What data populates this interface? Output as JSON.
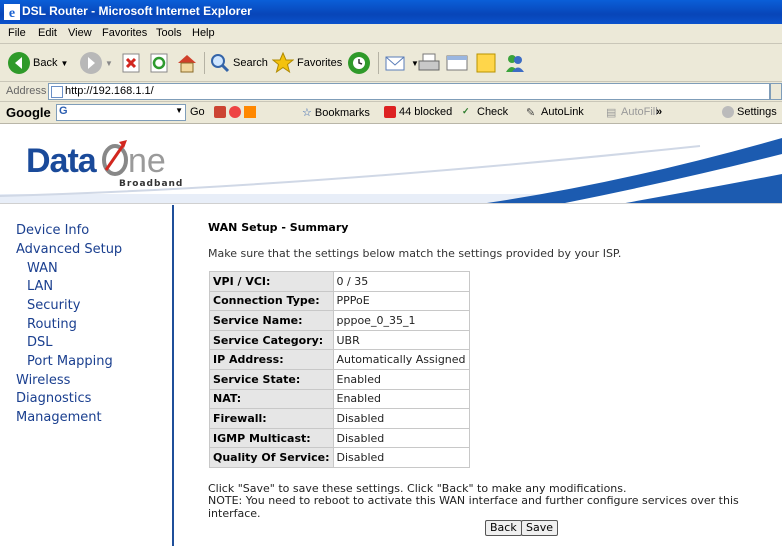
{
  "window": {
    "title": "DSL Router - Microsoft Internet Explorer"
  },
  "menu": [
    "File",
    "Edit",
    "View",
    "Favorites",
    "Tools",
    "Help"
  ],
  "toolbar": {
    "back": "Back",
    "search": "Search",
    "favorites": "Favorites"
  },
  "address": {
    "label": "Address",
    "url": "http://192.168.1.1/"
  },
  "google_toolbar": {
    "logo": "Google",
    "go": "Go",
    "bookmarks": "Bookmarks",
    "blocked": "44 blocked",
    "check": "Check",
    "autolink": "AutoLink",
    "autofill": "AutoFill",
    "settings": "Settings"
  },
  "banner": {
    "brand_a": "Data",
    "brand_b": "ne",
    "tagline": "Broadband"
  },
  "sidebar": {
    "items": [
      {
        "label": "Device Info",
        "level": 0
      },
      {
        "label": "Advanced Setup",
        "level": 0
      },
      {
        "label": "WAN",
        "level": 1
      },
      {
        "label": "LAN",
        "level": 1
      },
      {
        "label": "Security",
        "level": 1
      },
      {
        "label": "Routing",
        "level": 1
      },
      {
        "label": "DSL",
        "level": 1
      },
      {
        "label": "Port Mapping",
        "level": 1
      },
      {
        "label": "Wireless",
        "level": 0
      },
      {
        "label": "Diagnostics",
        "level": 0
      },
      {
        "label": "Management",
        "level": 0
      }
    ]
  },
  "main": {
    "heading": "WAN Setup - Summary",
    "intro": "Make sure that the settings below match the settings provided by your ISP.",
    "rows": [
      {
        "key": "VPI / VCI:",
        "value": "0 / 35"
      },
      {
        "key": "Connection Type:",
        "value": "PPPoE"
      },
      {
        "key": "Service Name:",
        "value": "pppoe_0_35_1"
      },
      {
        "key": "Service Category:",
        "value": "UBR"
      },
      {
        "key": "IP Address:",
        "value": "Automatically Assigned"
      },
      {
        "key": "Service State:",
        "value": "Enabled"
      },
      {
        "key": "NAT:",
        "value": "Enabled"
      },
      {
        "key": "Firewall:",
        "value": "Disabled"
      },
      {
        "key": "IGMP Multicast:",
        "value": "Disabled"
      },
      {
        "key": "Quality Of Service:",
        "value": "Disabled"
      }
    ],
    "note1": "Click \"Save\" to save these settings. Click \"Back\" to make any modifications.",
    "note2": "NOTE: You need to reboot to activate this WAN interface and further configure services over this interface.",
    "back_label": "Back",
    "save_label": "Save"
  }
}
